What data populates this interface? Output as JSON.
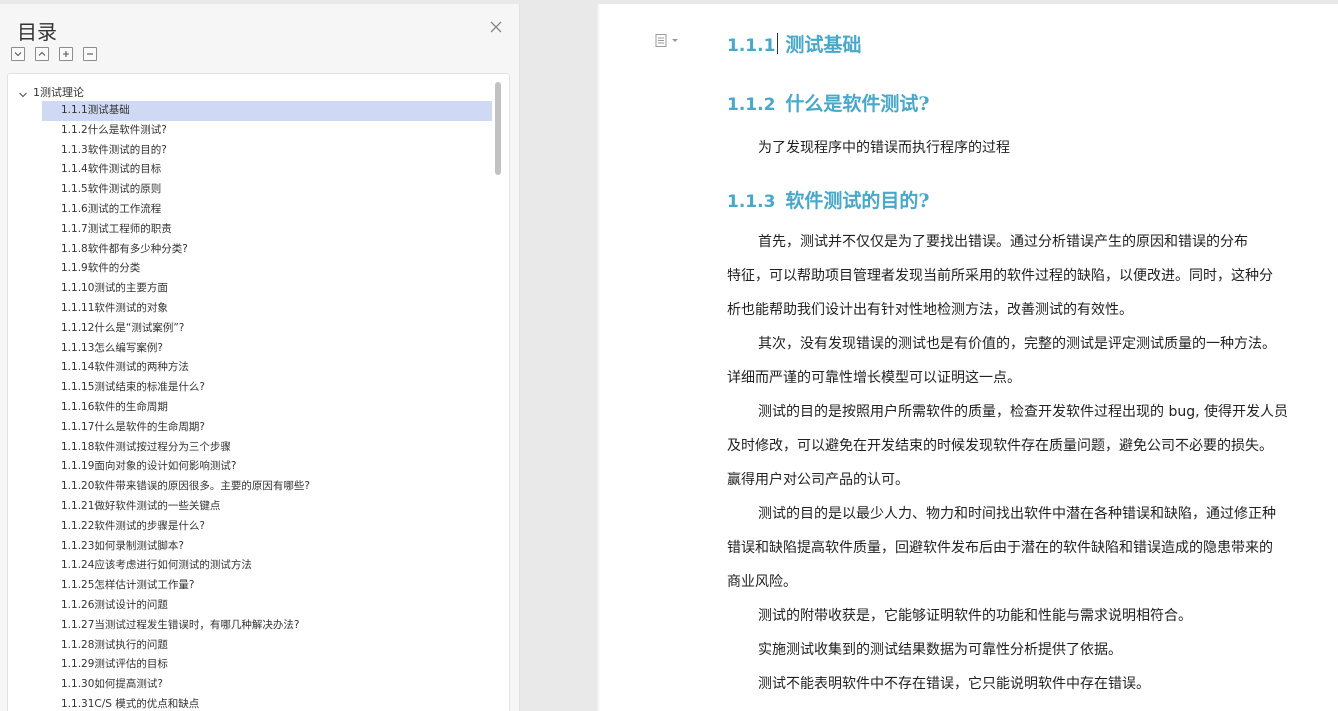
{
  "toc": {
    "title": "目录",
    "root_label": "1测试理论",
    "items": [
      "1.1.1测试基础",
      "1.1.2什么是软件测试?",
      "1.1.3软件测试的目的?",
      "1.1.4软件测试的目标",
      "1.1.5软件测试的原则",
      "1.1.6测试的工作流程",
      "1.1.7测试工程师的职责",
      "1.1.8软件都有多少种分类?",
      "1.1.9软件的分类",
      "1.1.10测试的主要方面",
      "1.1.11软件测试的对象",
      "1.1.12什么是“测试案例”?",
      "1.1.13怎么编写案例?",
      "1.1.14软件测试的两种方法",
      "1.1.15测试结束的标准是什么?",
      "1.1.16软件的生命周期",
      "1.1.17什么是软件的生命周期?",
      "1.1.18软件测试按过程分为三个步骤",
      "1.1.19面向对象的设计如何影响测试?",
      "1.1.20软件带来错误的原因很多。主要的原因有哪些?",
      "1.1.21做好软件测试的一些关键点",
      "1.1.22软件测试的步骤是什么?",
      "1.1.23如何录制测试脚本?",
      "1.1.24应该考虑进行如何测试的测试方法",
      "1.1.25怎样估计测试工作量?",
      "1.1.26测试设计的问题",
      "1.1.27当测试过程发生错误时，有哪几种解决办法?",
      "1.1.28测试执行的问题",
      "1.1.29测试评估的目标",
      "1.1.30如何提高测试?",
      "1.1.31C/S 模式的优点和缺点"
    ],
    "selected_index": 0
  },
  "document": {
    "headings": [
      {
        "num": "1.1.1",
        "text": "测试基础"
      },
      {
        "num": "1.1.2",
        "text": "什么是软件测试?"
      },
      {
        "num": "1.1.3",
        "text": "软件测试的目的?"
      }
    ],
    "def_para": "为了发现程序中的错误而执行程序的过程",
    "lines": [
      "首先，测试并不仅仅是为了要找出错误。通过分析错误产生的原因和错误的分布",
      "特征，可以帮助项目管理者发现当前所采用的软件过程的缺陷，以便改进。同时，这种分",
      "析也能帮助我们设计出有针对性地检测方法，改善测试的有效性。",
      "其次，没有发现错误的测试也是有价值的，完整的测试是评定测试质量的一种方法。",
      "详细而严谨的可靠性增长模型可以证明这一点。",
      "测试的目的是按照用户所需软件的质量，检查开发软件过程出现的 bug, 使得开发人员",
      "及时修改，可以避免在开发结束的时候发现软件存在质量问题，避免公司不必要的损失。",
      "赢得用户对公司产品的认可。",
      "测试的目的是以最少人力、物力和时间找出软件中潜在各种错误和缺陷，通过修正种",
      "错误和缺陷提高软件质量，回避软件发布后由于潜在的软件缺陷和错误造成的隐患带来的",
      "商业风险。",
      "测试的附带收获是，它能够证明软件的功能和性能与需求说明相符合。",
      "实施测试收集到的测试结果数据为可靠性分析提供了依据。",
      "测试不能表明软件中不存在错误，它只能说明软件中存在错误。"
    ]
  },
  "colors": {
    "heading": "#47a8c9",
    "selected_row": "#cfd9f3"
  }
}
